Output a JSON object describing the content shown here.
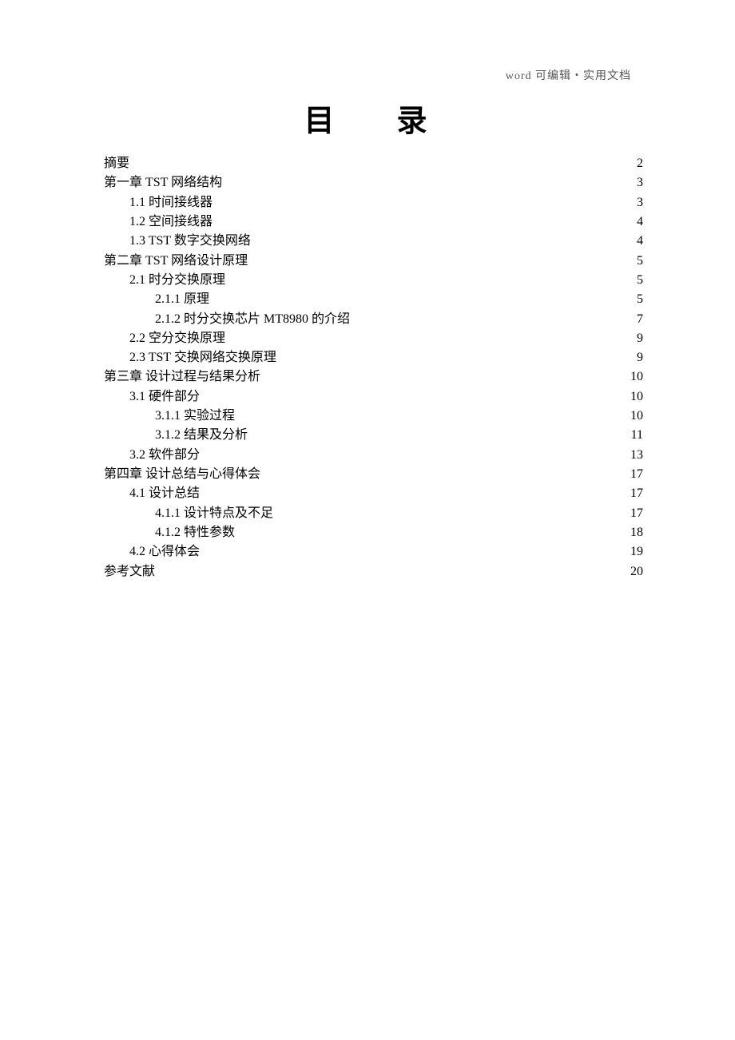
{
  "header_note": "word 可编辑・实用文档",
  "title": "目　录",
  "toc": [
    {
      "indent": 0,
      "label": "摘要",
      "page": "2"
    },
    {
      "indent": 0,
      "label": "第一章  TST 网络结构",
      "page": "3"
    },
    {
      "indent": 1,
      "label": "1.1  时间接线器",
      "page": "3"
    },
    {
      "indent": 1,
      "label": "1.2  空间接线器",
      "page": "4"
    },
    {
      "indent": 1,
      "label": "1.3 TST 数字交换网络 ",
      "page": "4"
    },
    {
      "indent": 0,
      "label": "第二章  TST 网络设计原理",
      "page": "5"
    },
    {
      "indent": 1,
      "label": "2.1  时分交换原理",
      "page": "5"
    },
    {
      "indent": 2,
      "label": "2.1.1    原理",
      "page": "5"
    },
    {
      "indent": 2,
      "label": "2.1.2    时分交换芯片 MT8980 的介绍",
      "page": "7"
    },
    {
      "indent": 1,
      "label": "2.2  空分交换原理",
      "page": "9"
    },
    {
      "indent": 1,
      "label": "2.3    TST 交换网络交换原理 ",
      "page": "9"
    },
    {
      "indent": 0,
      "label": "第三章  设计过程与结果分析",
      "page": "10"
    },
    {
      "indent": 1,
      "label": "3.1    硬件部分",
      "page": "10"
    },
    {
      "indent": 2,
      "label": "3.1.1    实验过程",
      "page": "10"
    },
    {
      "indent": 2,
      "label": "3.1.2    结果及分析",
      "page": "11"
    },
    {
      "indent": 1,
      "label": "3.2    软件部分 ",
      "page": "13"
    },
    {
      "indent": 0,
      "label": "第四章  设计总结与心得体会",
      "page": "17"
    },
    {
      "indent": 1,
      "label": "4.1  设计总结",
      "page": "17"
    },
    {
      "indent": 2,
      "label": "4.1.1    设计特点及不足",
      "page": "17"
    },
    {
      "indent": 2,
      "label": "4.1.2    特性参数",
      "page": "18"
    },
    {
      "indent": 1,
      "label": "4.2  心得体会 ",
      "page": "19"
    },
    {
      "indent": 0,
      "label": "参考文献",
      "page": "20"
    }
  ]
}
